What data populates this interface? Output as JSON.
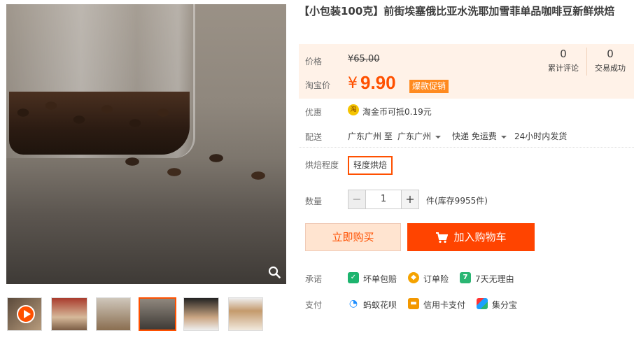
{
  "product": {
    "title": "【小包装100克】前街埃塞俄比亚水洗耶加雪菲单品咖啡豆新鲜烘焙"
  },
  "price": {
    "label": "价格",
    "original": "¥65.00",
    "taobao_label": "淘宝价",
    "currency": "¥",
    "current": "9.90",
    "promo_badge": "爆款促销"
  },
  "stats": [
    {
      "value": "0",
      "label": "累计评论"
    },
    {
      "value": "0",
      "label": "交易成功"
    }
  ],
  "discount": {
    "label": "优惠",
    "icon_text": "淘",
    "text": "淘金币可抵0.19元"
  },
  "shipping": {
    "label": "配送",
    "from": "广东广州 至",
    "to": "广东广州",
    "method": "快递 免运费",
    "dispatch": "24小时内发货"
  },
  "roast": {
    "label": "烘焙程度",
    "selected": "轻度烘焙"
  },
  "quantity": {
    "label": "数量",
    "minus": "−",
    "value": "1",
    "plus": "+",
    "stock": "件(库存9955件)"
  },
  "actions": {
    "buy_now": "立即购买",
    "add_to_cart": "加入购物车"
  },
  "promise": {
    "label": "承诺",
    "items": [
      {
        "icon": "guarantee-icon",
        "text": "坏单包赔",
        "color": "#1db46e"
      },
      {
        "icon": "order-insurance-icon",
        "text": "订单险",
        "color": "#f5a300"
      },
      {
        "icon": "seven-day-return-icon",
        "icon_text": "7",
        "text": "7天无理由",
        "color": "#2bb673"
      }
    ]
  },
  "payment": {
    "label": "支付",
    "items": [
      {
        "icon": "huabei-icon",
        "text": "蚂蚁花呗",
        "color": "#1a8cff"
      },
      {
        "icon": "credit-card-icon",
        "text": "信用卡支付",
        "color": "#f39800"
      },
      {
        "icon": "jifenbao-icon",
        "text": "集分宝",
        "color": "#2bb673"
      }
    ]
  },
  "colors": {
    "accent": "#ff5000",
    "price_bg": "#fff2e8",
    "buy_now_bg": "#ffe4d0",
    "cart_bg": "#ff4400"
  }
}
